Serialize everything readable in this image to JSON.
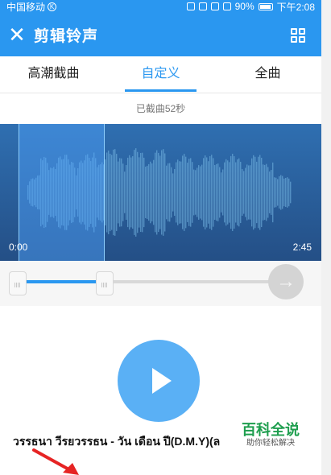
{
  "status_bar": {
    "carrier": "中国移动",
    "carrier_badge": "K",
    "battery": "90%",
    "time": "下午2:08"
  },
  "app_bar": {
    "title": "剪辑铃声",
    "close_icon": "close-icon",
    "menu_icon": "grid-icon"
  },
  "tabs": [
    {
      "label": "高潮截曲",
      "active": false
    },
    {
      "label": "自定义",
      "active": true
    },
    {
      "label": "全曲",
      "active": false
    }
  ],
  "cut_info": "已截曲52秒",
  "waveform": {
    "start_time": "0:00",
    "end_time": "2:45"
  },
  "player": {
    "play_icon": "play-icon"
  },
  "song_title": "วรรธนา วีรยวรรธน - วัน เดือน ปี(D.M.Y)(ล",
  "watermark": {
    "title": "百科全说",
    "subtitle": "助你轻松解决"
  },
  "colors": {
    "primary": "#2a97f0",
    "waveform_bg": "#2f6fb1",
    "selection": "#50a5ff",
    "watermark_green": "#1e9e4e",
    "annotation_red": "#e62424"
  }
}
